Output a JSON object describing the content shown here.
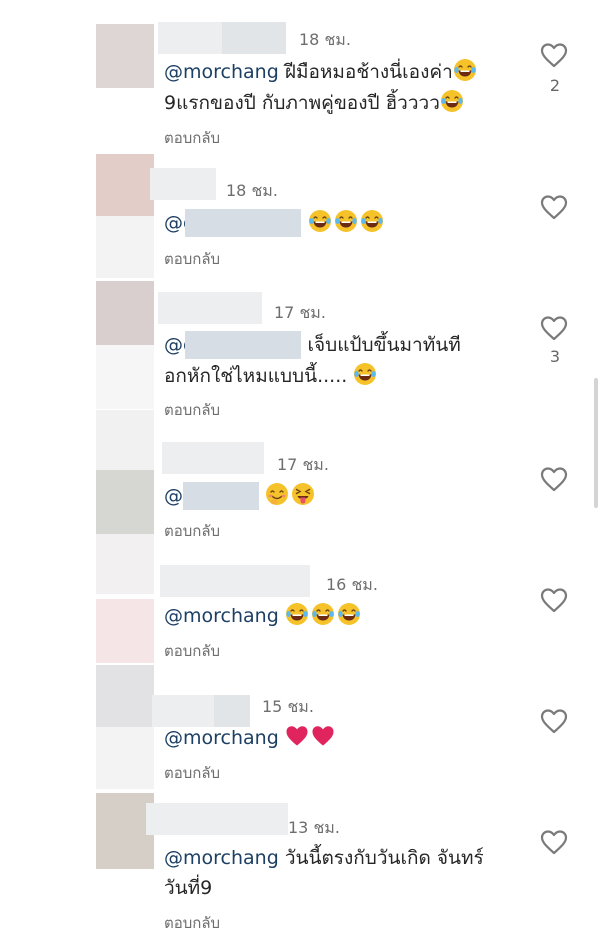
{
  "reply_label": "ตอบกลับ",
  "comments": [
    {
      "time": "18 ชม.",
      "mention": "@morchang",
      "text_1": "ฝีมือหมอช้างนี่เองค่า",
      "line2": "9แรกของปี กับภาพคู่ของปี ฮิ้วววว",
      "likes": "2"
    },
    {
      "time": "18 ชม.",
      "mention": "@c",
      "text": ""
    },
    {
      "time": "17 ชม.",
      "mention": "@c",
      "text": "เจ็บแป้บขึ้นมาทันที",
      "line2": "อกหักใช่ไหมแบบนี้.....",
      "likes": "3"
    },
    {
      "time": "17 ชม.",
      "mention": "@"
    },
    {
      "time": "16 ชม.",
      "mention": "@morchang"
    },
    {
      "time": "15 ชม.",
      "mention": "@morchang"
    },
    {
      "time": "13 ชม.",
      "mention": "@morchang",
      "text": "วันนี้ตรงกับวันเกิด จันทร์",
      "line2": "วันที่9"
    }
  ],
  "colors": {
    "text": "#262626",
    "mention": "#1d3f63",
    "meta": "#6e6e6e",
    "heart": "#7a7a7a",
    "red_heart": "#e0245e"
  },
  "icons": [
    "heart-outline-icon",
    "laughing-emoji",
    "heart-red-emoji",
    "smiling-emoji",
    "tongue-emoji"
  ]
}
